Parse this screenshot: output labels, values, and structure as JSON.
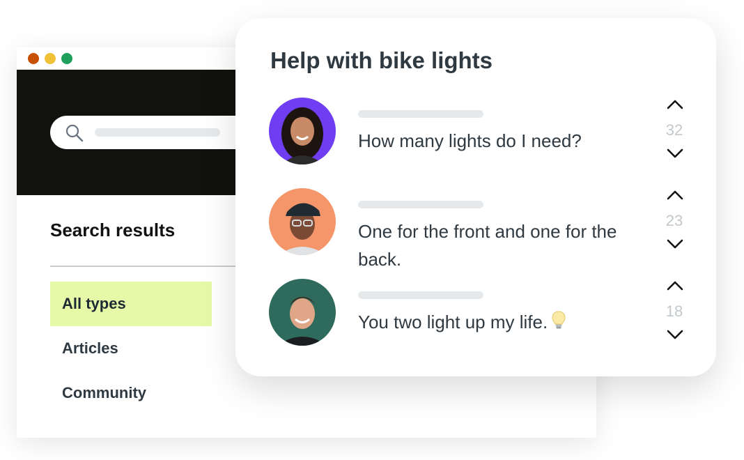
{
  "browser": {
    "window_controls": [
      "close",
      "minimize",
      "maximize"
    ],
    "search": {
      "icon": "search-icon"
    },
    "results_title": "Search results",
    "filters": [
      {
        "label": "All types",
        "active": true
      },
      {
        "label": "Articles",
        "active": false
      },
      {
        "label": "Community",
        "active": false
      }
    ],
    "accent_color": "#e6f9a8"
  },
  "card": {
    "title": "Help with bike lights",
    "posts": [
      {
        "text": "How many lights do I need?",
        "votes": "32",
        "avatar_bg": "#6f3df2"
      },
      {
        "text": "One for the front and one for the back.",
        "votes": "23",
        "avatar_bg": "#f4956a"
      },
      {
        "text": "You two light up my life.",
        "votes": "18",
        "avatar_bg": "#2f6b5d",
        "emoji_icon": "lightbulb-icon"
      }
    ]
  }
}
